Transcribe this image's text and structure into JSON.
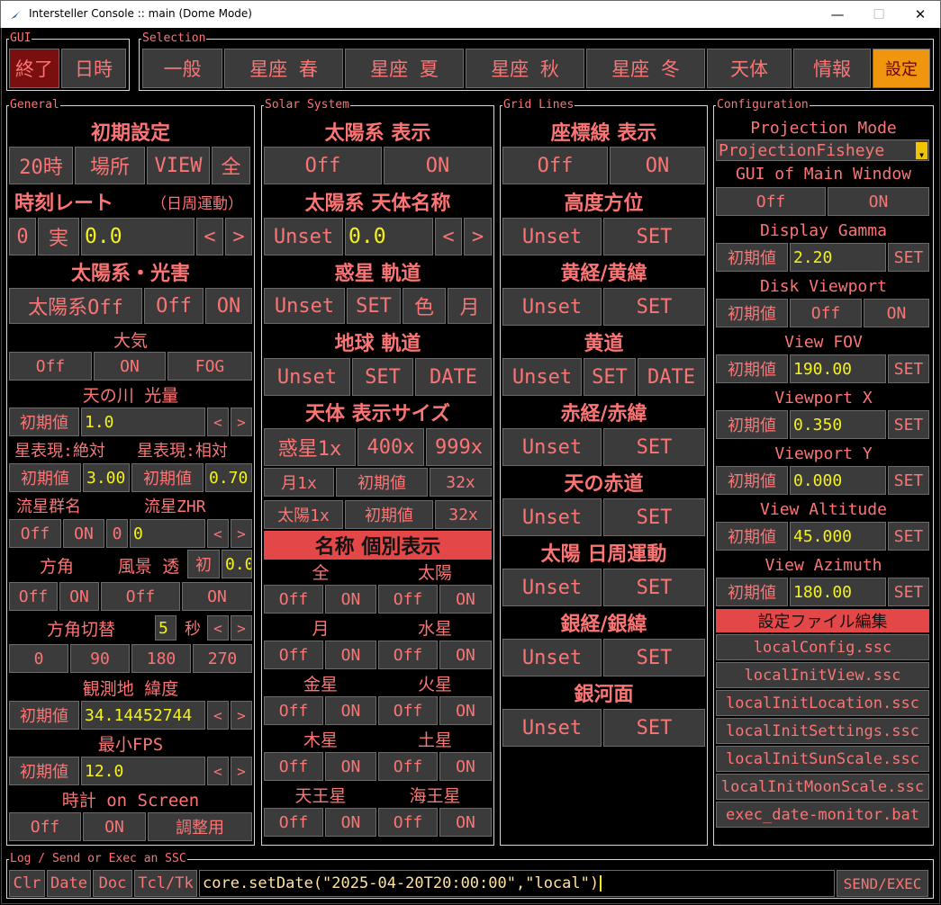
{
  "window": {
    "title": "Intersteller Console :: main (Dome Mode)",
    "min": "—",
    "max": "☐",
    "close": "✕"
  },
  "gui": {
    "title": "GUI",
    "quit": "終了",
    "datetime": "日時"
  },
  "selection": {
    "title": "Selection",
    "tabs": [
      "一般",
      "星座 春",
      "星座 夏",
      "星座 秋",
      "星座 冬",
      "天体",
      "情報",
      "設定"
    ]
  },
  "general": {
    "title": "General",
    "initial_settings": "初期設定",
    "init_buttons": [
      "20時",
      "場所",
      "VIEW",
      "全"
    ],
    "time_rate": "時刻レート",
    "time_rate_note": "（日周運動）",
    "rate_zero": "0",
    "rate_real": "実",
    "rate_value": "0.0",
    "arrow_left": "<",
    "arrow_right": ">",
    "solar_light": "太陽系・光害",
    "solar_buttons": [
      "太陽系Off",
      "Off",
      "ON"
    ],
    "atmosphere": "大気",
    "atmo_buttons": [
      "Off",
      "ON",
      "FOG"
    ],
    "milkyway": "天の川 光量",
    "milkyway_reset": "初期値",
    "milkyway_value": "1.0",
    "star_abs": "星表現:絶対",
    "star_rel": "星表現:相対",
    "star_abs_reset": "初期値",
    "star_abs_value": "3.00",
    "star_rel_reset": "初期値",
    "star_rel_value": "0.70",
    "meteor_name": "流星群名",
    "meteor_zhr": "流星ZHR",
    "meteor_off": "Off",
    "meteor_on": "ON",
    "meteor_zero": "0",
    "meteor_value": "0",
    "direction": "方角",
    "landscape": "風景 透",
    "landscape_init": "初",
    "landscape_value": "0.0",
    "dir_buttons": [
      "Off",
      "ON",
      "Off",
      "ON"
    ],
    "dir_switch": "方角切替",
    "dir_switch_value": "5",
    "dir_switch_unit": "秒",
    "angle_buttons": [
      "0",
      "90",
      "180",
      "270"
    ],
    "latitude": "観測地 緯度",
    "latitude_reset": "初期値",
    "latitude_value": "34.14452744",
    "min_fps": "最小FPS",
    "fps_reset": "初期値",
    "fps_value": "12.0",
    "clock": "時計 on Screen",
    "clock_buttons": [
      "Off",
      "ON",
      "調整用"
    ]
  },
  "solar": {
    "title": "Solar System",
    "display": "太陽系 表示",
    "display_buttons": [
      "Off",
      "ON"
    ],
    "names": "太陽系 天体名称",
    "names_unset": "Unset",
    "names_value": "0.0",
    "arrow_left": "<",
    "arrow_right": ">",
    "planet_orbit": "惑星 軌道",
    "planet_orbit_buttons": [
      "Unset",
      "SET",
      "色",
      "月"
    ],
    "earth_orbit": "地球 軌道",
    "earth_orbit_buttons": [
      "Unset",
      "SET",
      "DATE"
    ],
    "size": "天体 表示サイズ",
    "size_buttons": [
      "惑星1x",
      "400x",
      "999x"
    ],
    "moon_row": [
      "月1x",
      "初期値",
      "32x"
    ],
    "sun_row": [
      "太陽1x",
      "初期値",
      "32x"
    ],
    "names_individual": "名称 個別表示",
    "bodies": [
      {
        "a": "全",
        "b": "太陽"
      },
      {
        "a": "月",
        "b": "水星"
      },
      {
        "a": "金星",
        "b": "火星"
      },
      {
        "a": "木星",
        "b": "土星"
      },
      {
        "a": "天王星",
        "b": "海王星"
      }
    ],
    "off": "Off",
    "on": "ON"
  },
  "grid": {
    "title": "Grid Lines",
    "display": "座標線 表示",
    "display_buttons": [
      "Off",
      "ON"
    ],
    "items": [
      {
        "label": "高度方位",
        "buttons": [
          "Unset",
          "SET"
        ]
      },
      {
        "label": "黄経/黄緯",
        "buttons": [
          "Unset",
          "SET"
        ]
      },
      {
        "label": "黄道",
        "buttons": [
          "Unset",
          "SET",
          "DATE"
        ]
      },
      {
        "label": "赤経/赤緯",
        "buttons": [
          "Unset",
          "SET"
        ]
      },
      {
        "label": "天の赤道",
        "buttons": [
          "Unset",
          "SET"
        ]
      },
      {
        "label": "太陽 日周運動",
        "buttons": [
          "Unset",
          "SET"
        ]
      },
      {
        "label": "銀経/銀緯",
        "buttons": [
          "Unset",
          "SET"
        ]
      },
      {
        "label": "銀河面",
        "buttons": [
          "Unset",
          "SET"
        ]
      }
    ]
  },
  "config": {
    "title": "Configuration",
    "projection_mode": "Projection Mode",
    "projection_value": "ProjectionFisheye",
    "gui_main": "GUI of Main Window",
    "gui_main_buttons": [
      "Off",
      "ON"
    ],
    "gamma": "Display Gamma",
    "gamma_reset": "初期値",
    "gamma_value": "2.20",
    "gamma_set": "SET",
    "disk": "Disk Viewport",
    "disk_buttons": [
      "初期値",
      "Off",
      "ON"
    ],
    "fov": "View FOV",
    "fov_reset": "初期値",
    "fov_value": "190.00",
    "fov_set": "SET",
    "vx": "Viewport X",
    "vx_reset": "初期値",
    "vx_value": "0.350",
    "vx_set": "SET",
    "vy": "Viewport Y",
    "vy_reset": "初期値",
    "vy_value": "0.000",
    "vy_set": "SET",
    "alt": "View Altitude",
    "alt_reset": "初期値",
    "alt_value": "45.000",
    "alt_set": "SET",
    "az": "View Azimuth",
    "az_reset": "初期値",
    "az_value": "180.00",
    "az_set": "SET",
    "edit_files": "設定ファイル編集",
    "files": [
      "localConfig.ssc",
      "localInitView.ssc",
      "localInitLocation.ssc",
      "localInitSettings.ssc",
      "localInitSunScale.ssc",
      "localInitMoonScale.ssc",
      "exec_date-monitor.bat"
    ]
  },
  "log": {
    "title": "Log / Send or Exec an SSC",
    "buttons": [
      "Clr",
      "Date",
      "Doc",
      "Tcl/Tk"
    ],
    "command": "core.setDate(\"2025-04-20T20:00:00\",\"local\")",
    "send": "SEND/EXEC"
  },
  "colors": {
    "accent": "#fb7575",
    "value": "#f4f21a",
    "button": "#3b3b3b",
    "active": "#7a0f0f",
    "selected_tab": "#f0960e",
    "highlight": "#e34747"
  }
}
